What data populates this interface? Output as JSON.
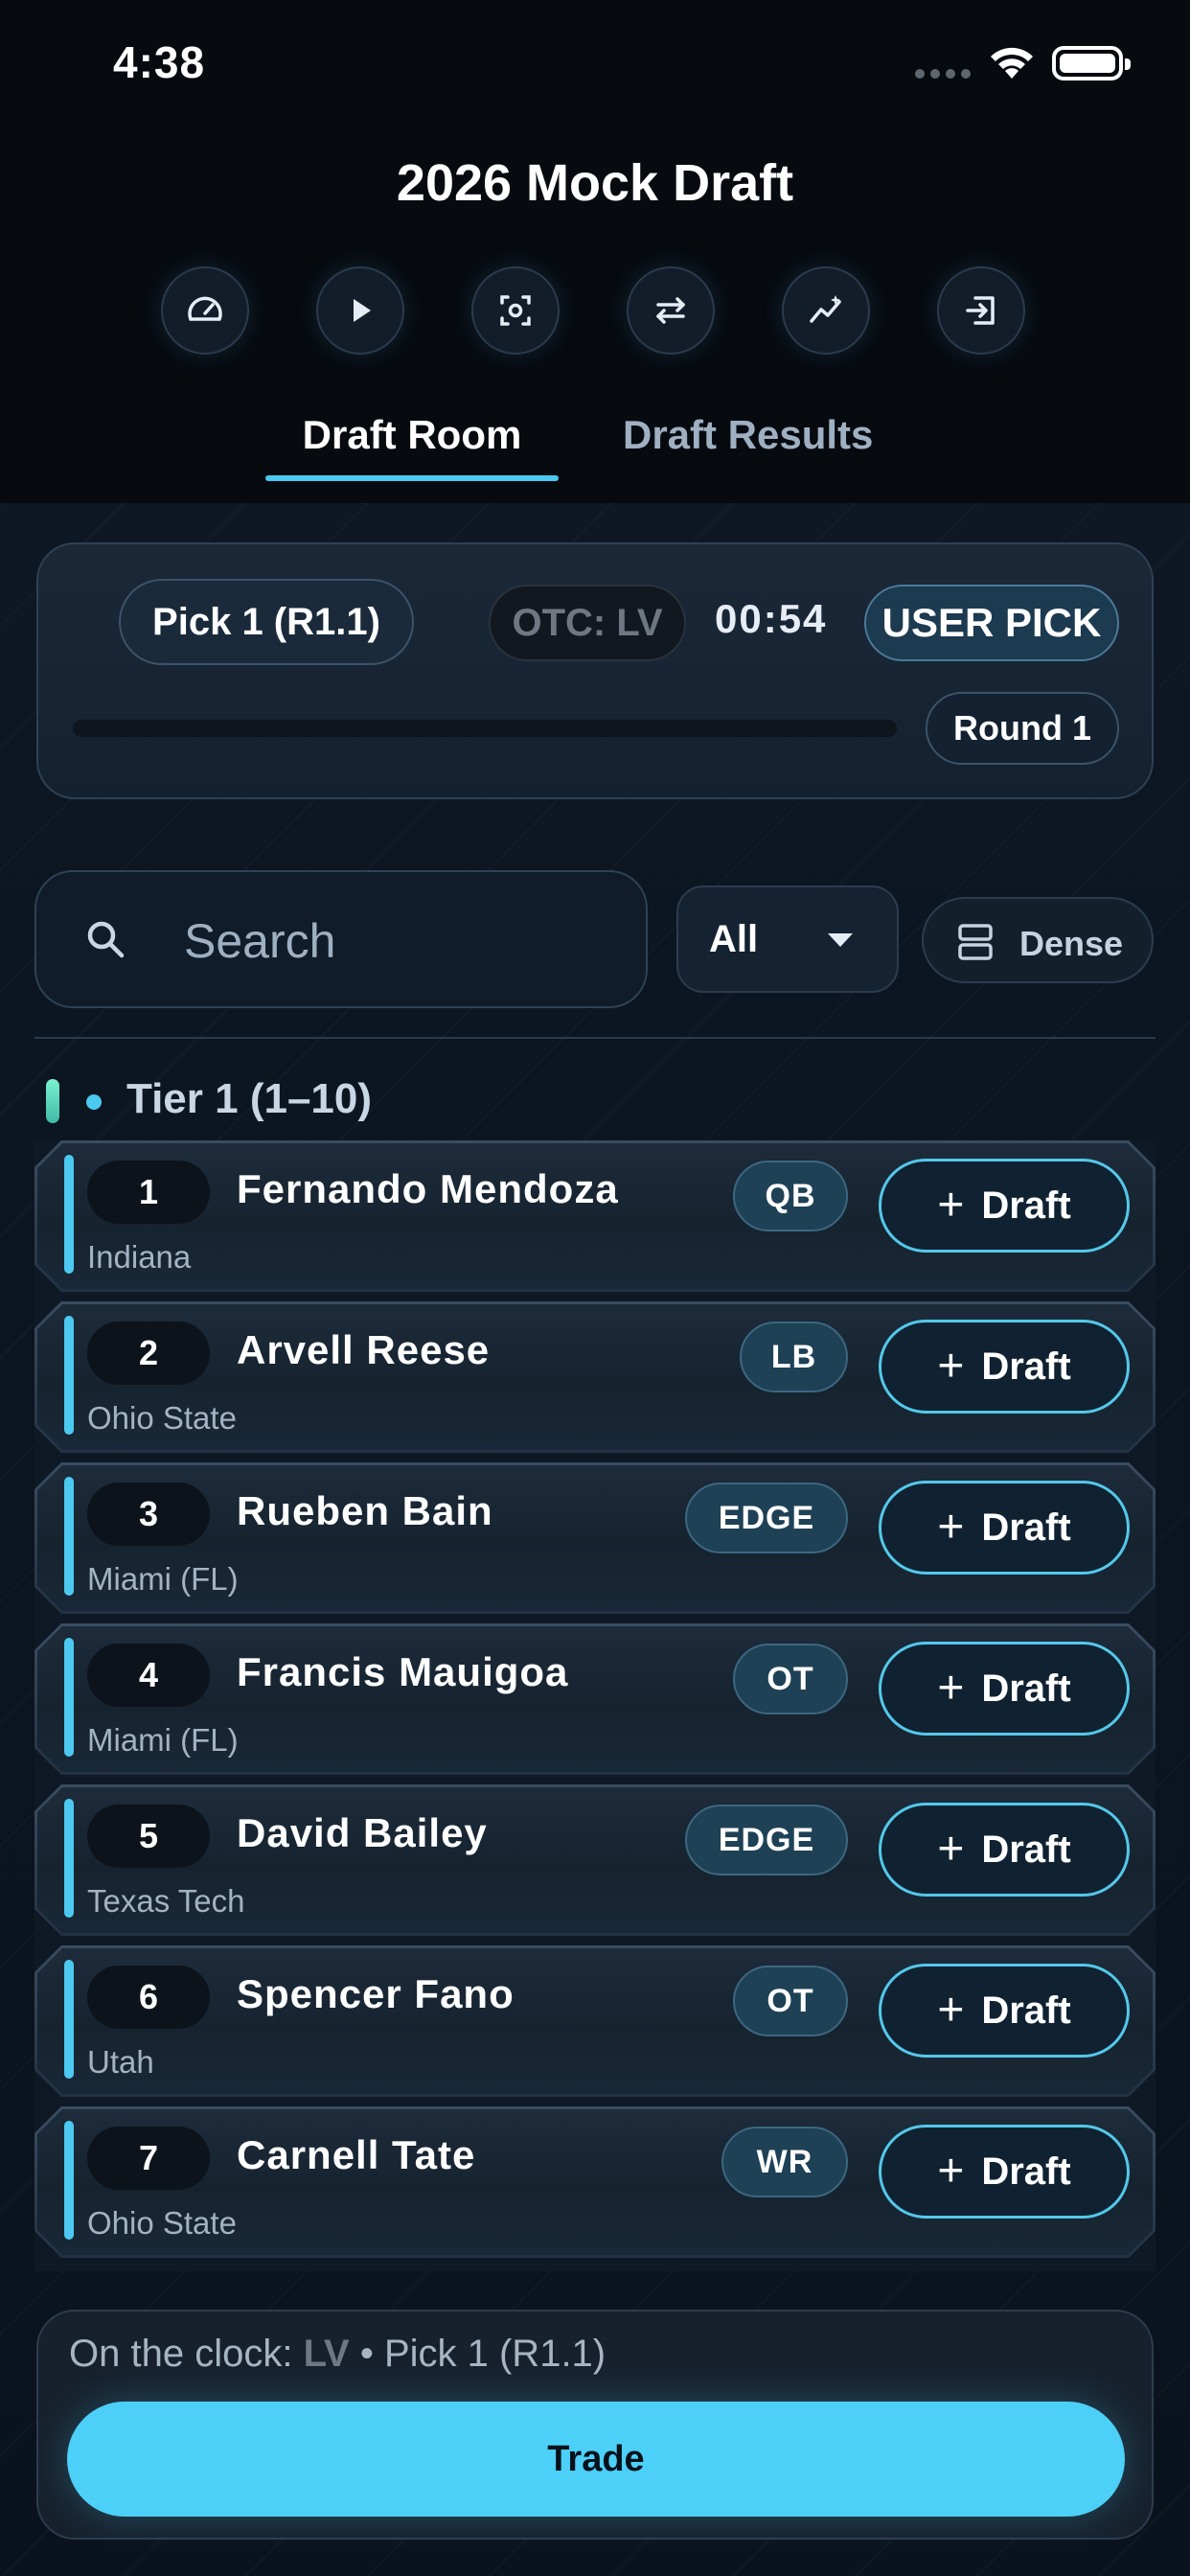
{
  "status_bar": {
    "time": "4:38"
  },
  "header": {
    "title": "2026 Mock Draft"
  },
  "toolbar_icons": [
    "speedometer-icon",
    "play-icon",
    "scan-icon",
    "swap-icon",
    "trend-icon",
    "exit-icon"
  ],
  "tabs": [
    {
      "label": "Draft Room",
      "active": true
    },
    {
      "label": "Draft Results",
      "active": false
    }
  ],
  "pick_card": {
    "pick_label": "Pick 1 (R1.1)",
    "otc_label": "OTC: LV",
    "timer": "00:54",
    "user_pick_label": "USER PICK",
    "round_label": "Round 1",
    "progress": 0
  },
  "search": {
    "placeholder": "Search",
    "value": ""
  },
  "filter": {
    "selected": "All"
  },
  "density_toggle": {
    "label": "Dense"
  },
  "tier": {
    "label": "Tier 1 (1–10)"
  },
  "players": [
    {
      "rank": "1",
      "name": "Fernando Mendoza",
      "school": "Indiana",
      "position": "QB"
    },
    {
      "rank": "2",
      "name": "Arvell Reese",
      "school": "Ohio State",
      "position": "LB"
    },
    {
      "rank": "3",
      "name": "Rueben Bain",
      "school": "Miami (FL)",
      "position": "EDGE"
    },
    {
      "rank": "4",
      "name": "Francis Mauigoa",
      "school": "Miami (FL)",
      "position": "OT"
    },
    {
      "rank": "5",
      "name": "David Bailey",
      "school": "Texas Tech",
      "position": "EDGE"
    },
    {
      "rank": "6",
      "name": "Spencer Fano",
      "school": "Utah",
      "position": "OT"
    },
    {
      "rank": "7",
      "name": "Carnell Tate",
      "school": "Ohio State",
      "position": "WR"
    }
  ],
  "draft_button_label": "Draft",
  "bottom": {
    "on_clock_prefix": "On the clock: ",
    "on_clock_team": "LV",
    "on_clock_suffix": " • Pick 1 (R1.1)",
    "trade_label": "Trade"
  },
  "colors": {
    "accent": "#4cc9f0",
    "trade_button": "#4dd0f8",
    "background": "#070b10"
  }
}
